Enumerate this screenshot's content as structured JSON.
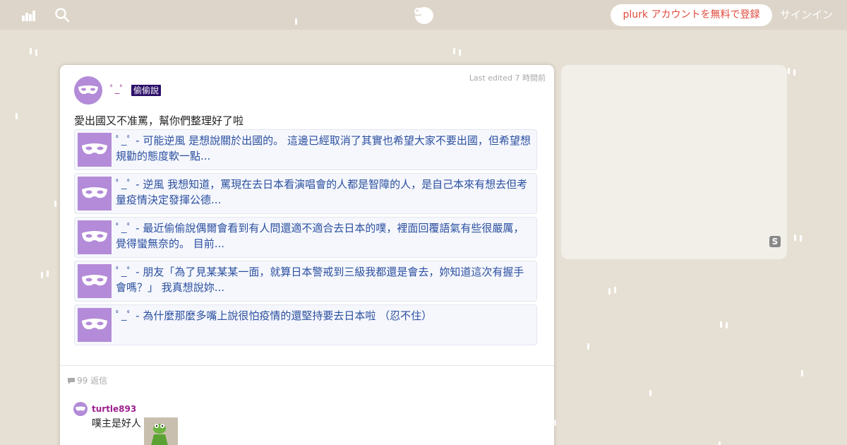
{
  "topbar": {
    "signup_label": "plurk アカウントを無料で登録",
    "signin_label": "サインイン"
  },
  "post": {
    "author": "ﾟ_ﾟ",
    "qualifier": "偷偷說",
    "edited": "Last edited 7 時間前",
    "text": "愛出國又不准罵，幫你們整理好了啦",
    "quotes": [
      "ﾟ_ﾟ - 可能逆風 是想說關於出國的。 這邊已經取消了其實也希望大家不要出國，但希望想規勸的態度軟一點...",
      "ﾟ_ﾟ - 逆風 我想知道，罵現在去日本看演唱會的人都是智障的人，是自己本來有想去但考量疫情決定發揮公德...",
      "ﾟ_ﾟ - 最近偷偷說偶爾會看到有人問還適不適合去日本的噗，裡面回覆語氣有些很嚴厲，覺得蠻無奈的。 目前...",
      "ﾟ_ﾟ - 朋友「為了見某某某一面，就算日本警戒到三級我都還是會去，妳知道這次有握手會嗎？」 我真想說妳...",
      "ﾟ_ﾟ - 為什麼那麼多嘴上說很怕疫情的還堅持要去日本啦 （忍不住）"
    ],
    "replies_count": "99 返信"
  },
  "reply": {
    "name": "turtle893",
    "text": "噗主是好人"
  },
  "side": {
    "badge": "S"
  },
  "colors": {
    "accent": "#e0493a",
    "name": "#9d1e8c",
    "qualifier_bg": "#2c0f68",
    "link": "#2b4fa0",
    "avatar": "#b38bd8"
  }
}
